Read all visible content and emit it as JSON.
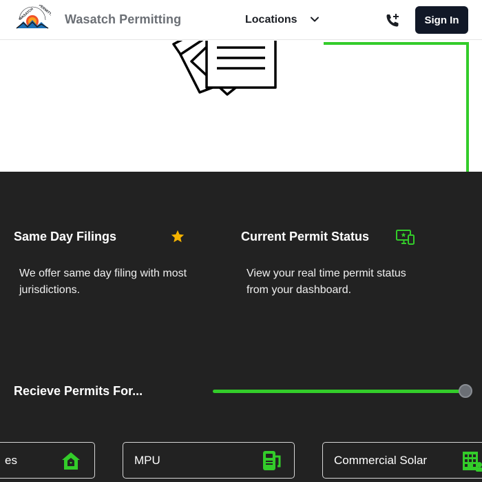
{
  "header": {
    "brand": "Wasatch Permitting",
    "logo_text": "WASATCH PERMITTING",
    "nav_locations": "Locations",
    "sign_in": "Sign In"
  },
  "features": [
    {
      "title": "Same Day Filings",
      "description": "We offer same day filing with most jurisdictions.",
      "icon": "star-icon"
    },
    {
      "title": "Current Permit Status",
      "description": "View your real time permit status from your dashboard.",
      "icon": "monitor-icon"
    }
  ],
  "permits": {
    "heading": "Recieve Permits For...",
    "slider_level": 1.0,
    "cards": [
      {
        "label": "es",
        "icon": "house-icon"
      },
      {
        "label": "MPU",
        "icon": "fuel-pump-icon"
      },
      {
        "label": "Commercial Solar",
        "icon": "building-icon"
      }
    ]
  },
  "colors": {
    "accent": "#33cc2a",
    "dark_bg": "#222222",
    "signin_bg": "#111827",
    "star": "#f5b300",
    "brand_text": "#6b6f75"
  }
}
